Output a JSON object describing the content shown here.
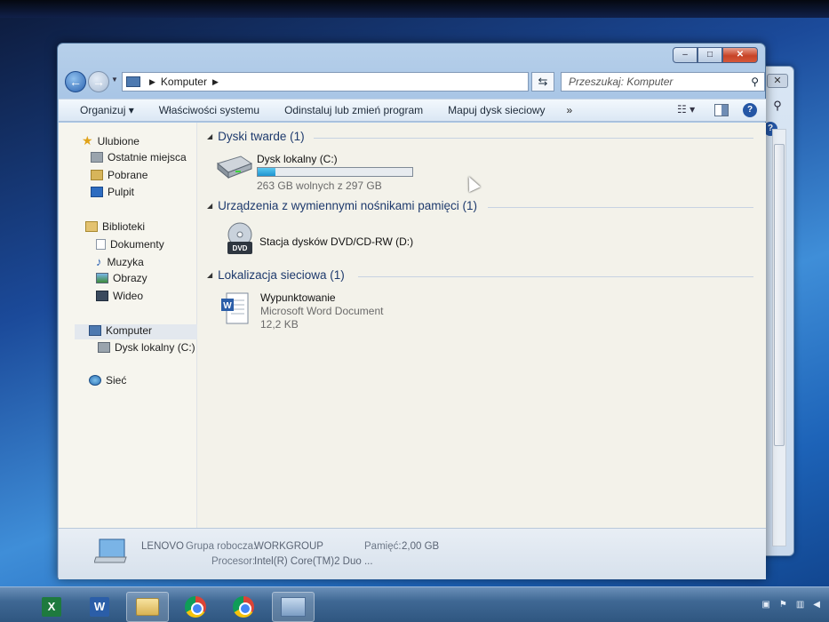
{
  "window": {
    "breadcrumb": "Komputer",
    "search_placeholder": "Przeszukaj: Komputer",
    "controls": {
      "minimize": "–",
      "maximize": "□",
      "close": "✕"
    }
  },
  "toolbar": {
    "organize": "Organizuj",
    "system_properties": "Właściwości systemu",
    "uninstall": "Odinstaluj lub zmień program",
    "map_drive": "Mapuj dysk sieciowy",
    "more": "»"
  },
  "nav": {
    "favorites": "Ulubione",
    "recent": "Ostatnie miejsca",
    "downloads": "Pobrane",
    "desktop": "Pulpit",
    "libraries": "Biblioteki",
    "documents": "Dokumenty",
    "music": "Muzyka",
    "pictures": "Obrazy",
    "videos": "Wideo",
    "computer": "Komputer",
    "local_disk": "Dysk lokalny (C:)",
    "network": "Sieć"
  },
  "content": {
    "hard_disks_header": "Dyski twarde (1)",
    "disk_name": "Dysk lokalny (C:)",
    "disk_free": "263 GB wolnych z 297 GB",
    "disk_used_fraction": 0.115,
    "removable_header": "Urządzenia z wymiennymi nośnikami pamięci (1)",
    "dvd_name": "Stacja dysków DVD/CD-RW (D:)",
    "dvd_label": "DVD",
    "network_header": "Lokalizacja sieciowa (1)",
    "file_name": "Wypunktowanie",
    "file_type": "Microsoft Word Document",
    "file_size": "12,2 KB"
  },
  "details": {
    "computer_name": "LENOVO",
    "workgroup_label": "Grupa robocza:",
    "workgroup_value": "WORKGROUP",
    "memory_label": "Pamięć:",
    "memory_value": "2,00 GB",
    "processor_label": "Procesor:",
    "processor_value": "Intel(R) Core(TM)2 Duo ..."
  },
  "taskbar": {
    "excel_letter": "X",
    "word_letter": "W"
  },
  "colors": {
    "accent": "#2a62b0",
    "disk_fill": "#1e93cf"
  }
}
